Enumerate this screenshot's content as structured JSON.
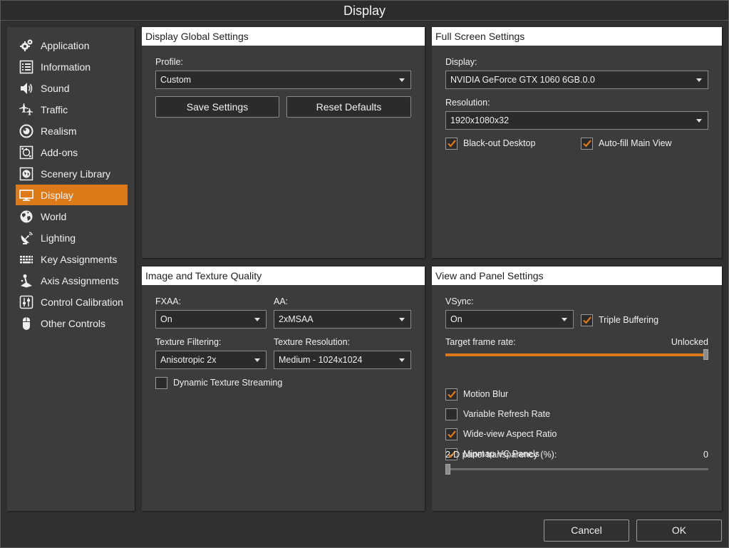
{
  "window": {
    "title": "Display"
  },
  "sidebar": {
    "items": [
      {
        "label": "Application",
        "icon": "gears-icon"
      },
      {
        "label": "Information",
        "icon": "list-icon"
      },
      {
        "label": "Sound",
        "icon": "speaker-icon"
      },
      {
        "label": "Traffic",
        "icon": "airplanes-icon"
      },
      {
        "label": "Realism",
        "icon": "target-icon"
      },
      {
        "label": "Add-ons",
        "icon": "plugin-icon"
      },
      {
        "label": "Scenery Library",
        "icon": "globe-box-icon"
      },
      {
        "label": "Display",
        "icon": "monitor-icon",
        "active": true
      },
      {
        "label": "World",
        "icon": "globe-icon"
      },
      {
        "label": "Lighting",
        "icon": "satellite-dish-icon"
      },
      {
        "label": "Key Assignments",
        "icon": "keyboard-icon"
      },
      {
        "label": "Axis Assignments",
        "icon": "joystick-icon"
      },
      {
        "label": "Control Calibration",
        "icon": "sliders-icon"
      },
      {
        "label": "Other Controls",
        "icon": "mouse-icon"
      }
    ],
    "accent_color": "#dc7a1a"
  },
  "display_global": {
    "title": "Display Global Settings",
    "profile_label": "Profile:",
    "profile_value": "Custom",
    "save_label": "Save Settings",
    "reset_label": "Reset Defaults"
  },
  "full_screen": {
    "title": "Full Screen Settings",
    "display_label": "Display:",
    "display_value": "NVIDIA GeForce GTX 1060 6GB.0.0",
    "resolution_label": "Resolution:",
    "resolution_value": "1920x1080x32",
    "blackout_label": "Black-out Desktop",
    "blackout_checked": true,
    "autofill_label": "Auto-fill Main View",
    "autofill_checked": true
  },
  "image_texture": {
    "title": "Image and Texture Quality",
    "fxaa_label": "FXAA:",
    "fxaa_value": "On",
    "aa_label": "AA:",
    "aa_value": "2xMSAA",
    "filtering_label": "Texture Filtering:",
    "filtering_value": "Anisotropic 2x",
    "resolution_label": "Texture Resolution:",
    "resolution_value": "Medium - 1024x1024",
    "streaming_label": "Dynamic Texture Streaming",
    "streaming_checked": false
  },
  "view_panel": {
    "title": "View and Panel Settings",
    "vsync_label": "VSync:",
    "vsync_value": "On",
    "triple_label": "Triple Buffering",
    "triple_checked": true,
    "framerate_label": "Target frame rate:",
    "framerate_value": "Unlocked",
    "framerate_fraction": 1.0,
    "motion_blur_label": "Motion Blur",
    "motion_blur_checked": true,
    "vrr_label": "Variable Refresh Rate",
    "vrr_checked": false,
    "wide_label": "Wide-view Aspect Ratio",
    "wide_checked": true,
    "mipmap_label": "Mipmap VC Panels",
    "mipmap_checked": true,
    "transparency_label": "2-D panel transparency (%):",
    "transparency_value": "0",
    "transparency_fraction": 0.0
  },
  "footer": {
    "cancel_label": "Cancel",
    "ok_label": "OK"
  }
}
